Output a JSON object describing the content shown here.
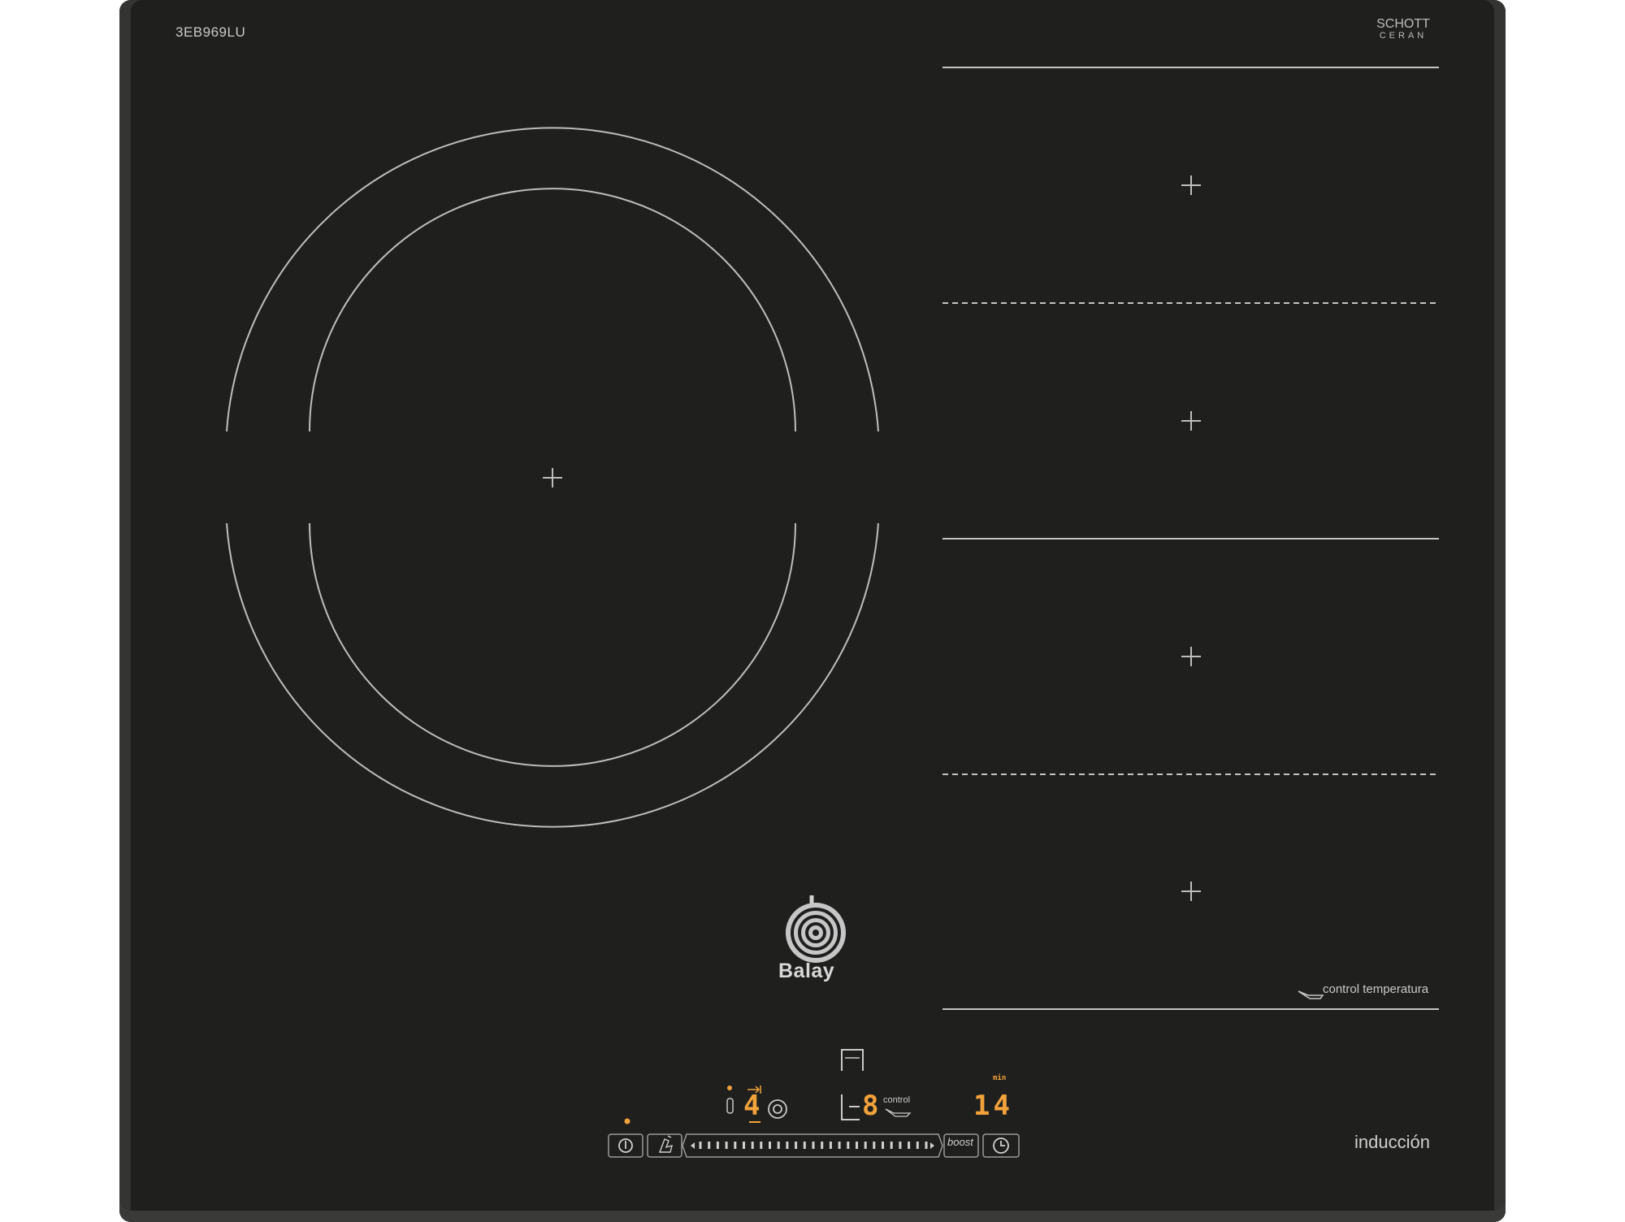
{
  "cooktop": {
    "model": "3EB969LU",
    "glass_brand_line1": "SCHOTT",
    "glass_brand_line2": "CERAN",
    "brand": "Balay",
    "temperature_control_label": "control temperatura",
    "type_label": "inducción"
  },
  "controls": {
    "power_level_display": "4",
    "cooking_level_display": "8",
    "control_label": "control",
    "timer_unit": "min",
    "timer_display": "14",
    "boost_label": "boost",
    "slider_ticks": 27
  },
  "colors": {
    "glass": "#1f1f1e",
    "frame": "#343433",
    "marking": "#c9c9c9",
    "display": "#f2a23a"
  },
  "icons": [
    "power-icon",
    "child-lock-icon",
    "boost-button",
    "timer-icon",
    "flex-zone-icon",
    "frying-sensor-icon"
  ]
}
